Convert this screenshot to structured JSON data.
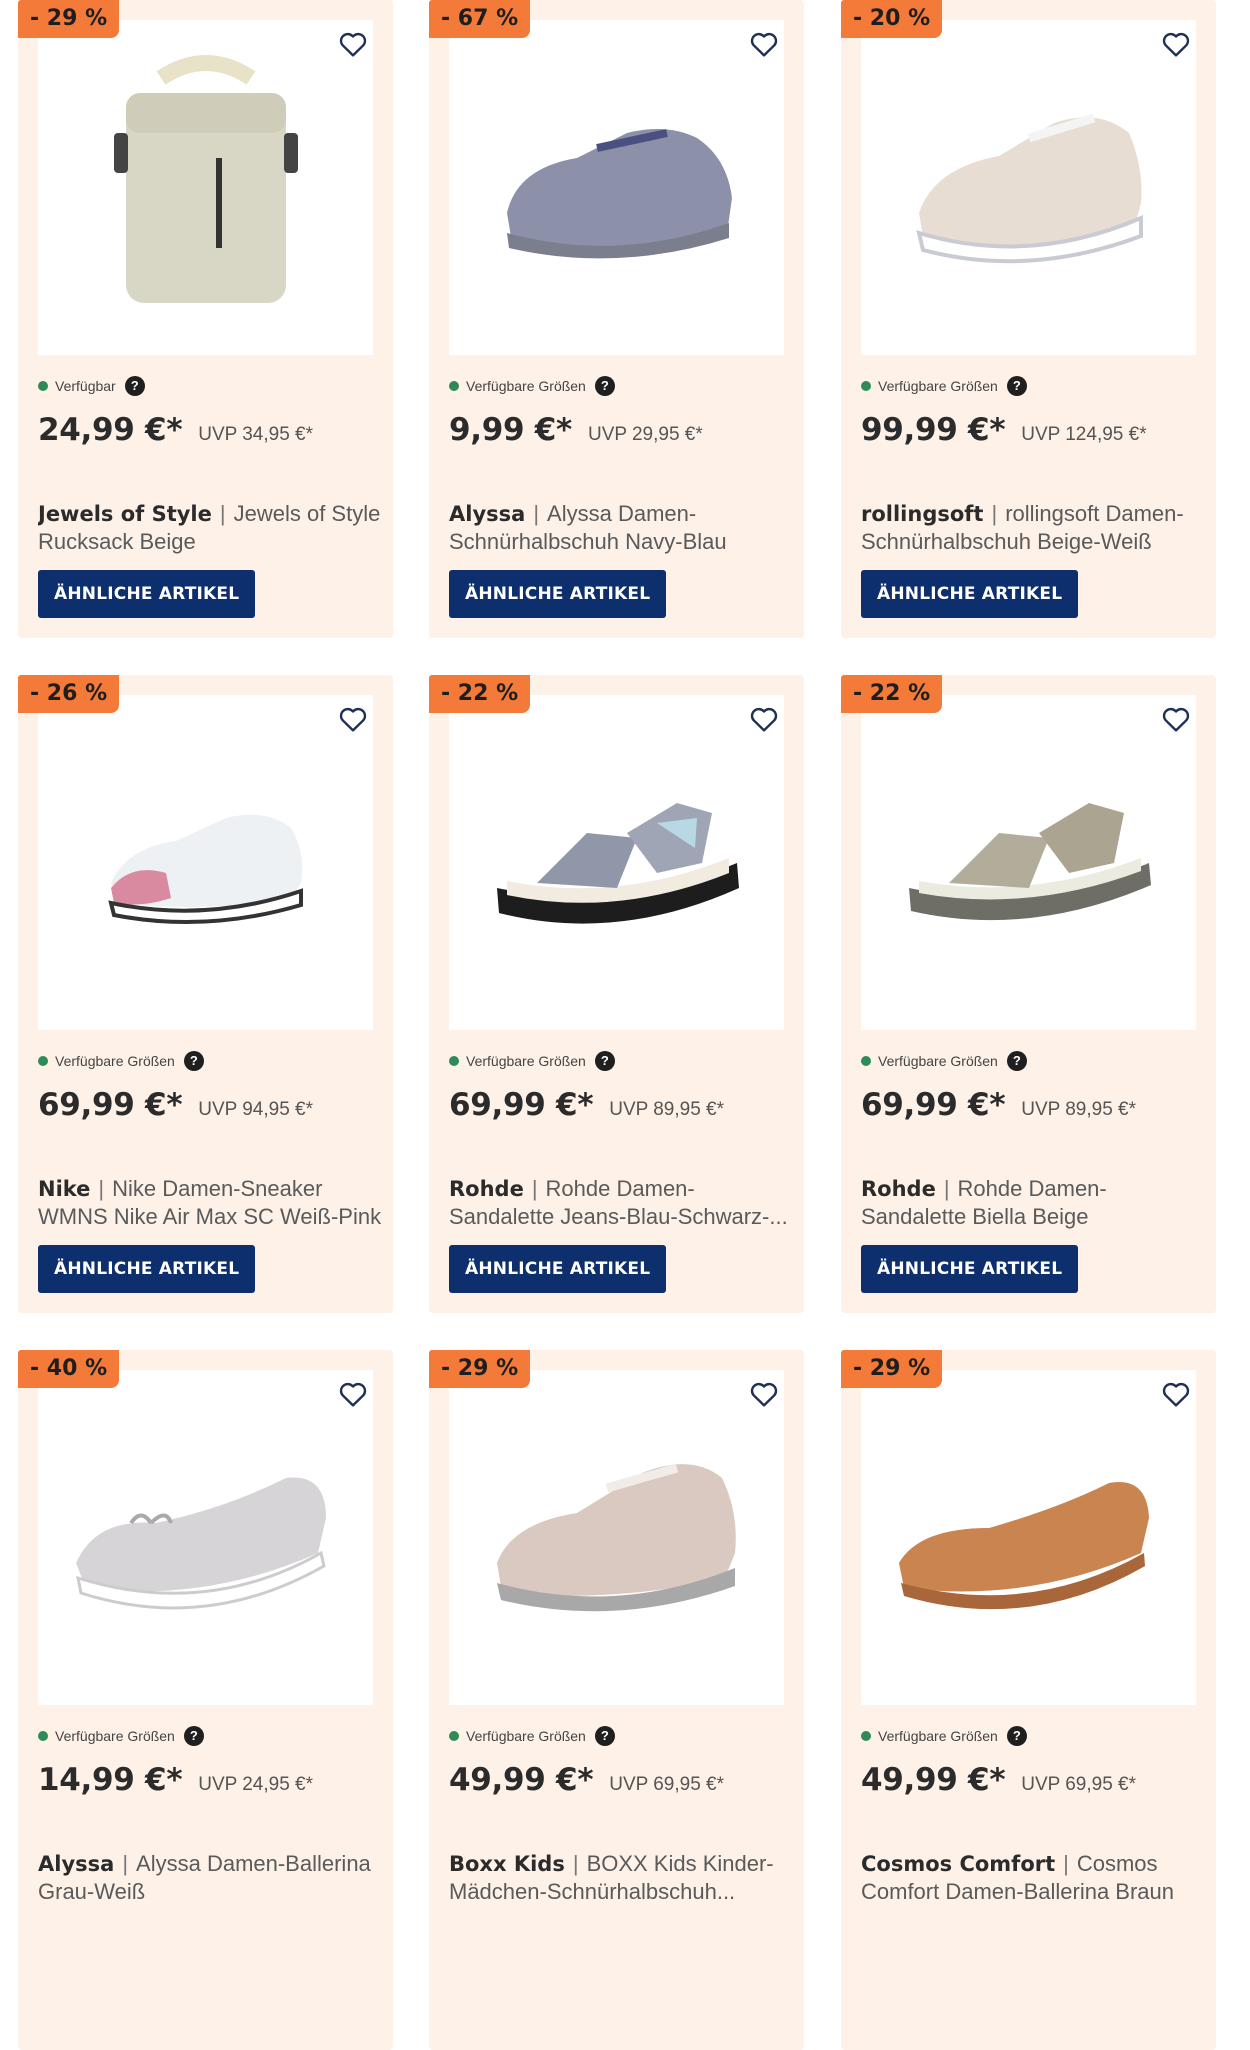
{
  "products": [
    {
      "discount": "- 29 %",
      "availability": "Verfügbar",
      "help": "?",
      "price": "24,99 €*",
      "uvp": "UVP 34,95 €*",
      "brand": "Jewels of Style",
      "separator": "|",
      "name": "Jewels of Style Rucksack Beige",
      "button": "ÄHNLICHE ARTIKEL",
      "image": "backpack"
    },
    {
      "discount": "- 67 %",
      "availability": "Verfügbare Größen",
      "help": "?",
      "price": "9,99 €*",
      "uvp": "UVP 29,95 €*",
      "brand": "Alyssa",
      "separator": "|",
      "name": "Alyssa Damen-Schnürhalbschuh Navy-Blau",
      "button": "ÄHNLICHE ARTIKEL",
      "image": "sneaker-navy"
    },
    {
      "discount": "- 20 %",
      "availability": "Verfügbare Größen",
      "help": "?",
      "price": "99,99 €*",
      "uvp": "UVP 124,95 €*",
      "brand": "rollingsoft",
      "separator": "|",
      "name": "rollingsoft Damen-Schnürhalbschuh Beige-Weiß",
      "button": "ÄHNLICHE ARTIKEL",
      "image": "sneaker-beige"
    },
    {
      "discount": "- 26 %",
      "availability": "Verfügbare Größen",
      "help": "?",
      "price": "69,99 €*",
      "uvp": "UVP 94,95 €*",
      "brand": "Nike",
      "separator": "|",
      "name": "Nike Damen-Sneaker WMNS Nike Air Max SC Weiß-Pink",
      "button": "ÄHNLICHE ARTIKEL",
      "image": "sneaker-pink"
    },
    {
      "discount": "- 22 %",
      "availability": "Verfügbare Größen",
      "help": "?",
      "price": "69,99 €*",
      "uvp": "UVP 89,95 €*",
      "brand": "Rohde",
      "separator": "|",
      "name": "Rohde Damen-Sandalette Jeans-Blau-Schwarz-...",
      "button": "ÄHNLICHE ARTIKEL",
      "image": "sandal-blue"
    },
    {
      "discount": "- 22 %",
      "availability": "Verfügbare Größen",
      "help": "?",
      "price": "69,99 €*",
      "uvp": "UVP 89,95 €*",
      "brand": "Rohde",
      "separator": "|",
      "name": "Rohde Damen-Sandalette Biella Beige",
      "button": "ÄHNLICHE ARTIKEL",
      "image": "sandal-beige"
    },
    {
      "discount": "- 40 %",
      "availability": "Verfügbare Größen",
      "help": "?",
      "price": "14,99 €*",
      "uvp": "UVP 24,95 €*",
      "brand": "Alyssa",
      "separator": "|",
      "name": "Alyssa Damen-Ballerina Grau-Weiß",
      "button": "",
      "image": "ballerina-grey"
    },
    {
      "discount": "- 29 %",
      "availability": "Verfügbare Größen",
      "help": "?",
      "price": "49,99 €*",
      "uvp": "UVP 69,95 €*",
      "brand": "Boxx Kids",
      "separator": "|",
      "name": "BOXX Kids Kinder-Mädchen-Schnürhalbschuh...",
      "button": "",
      "image": "sneaker-rose"
    },
    {
      "discount": "- 29 %",
      "availability": "Verfügbare Größen",
      "help": "?",
      "price": "49,99 €*",
      "uvp": "UVP 69,95 €*",
      "brand": "Cosmos Comfort",
      "separator": "|",
      "name": "Cosmos Comfort Damen-Ballerina Braun",
      "button": "",
      "image": "ballerina-brown"
    }
  ],
  "colors": {
    "card_bg": "#fdf1e8",
    "badge": "#f47a3a",
    "button": "#0d2f6e",
    "available_dot": "#2e8b57"
  },
  "icons": {
    "wishlist": "heart-icon",
    "availability": "dot-icon",
    "help": "question-icon"
  }
}
